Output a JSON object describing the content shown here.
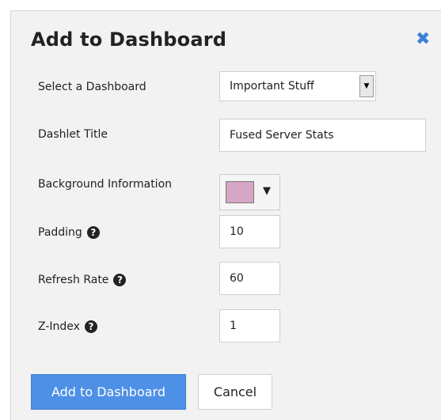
{
  "dialog": {
    "title": "Add to Dashboard",
    "close_icon": "close-icon"
  },
  "form": {
    "dashboard": {
      "label": "Select a Dashboard",
      "value": "Important Stuff"
    },
    "dashlet_title": {
      "label": "Dashlet Title",
      "value": "Fused Server Stats"
    },
    "background": {
      "label": "Background Information",
      "color": "#d7a6c6"
    },
    "padding": {
      "label": "Padding",
      "value": "10"
    },
    "refresh_rate": {
      "label": "Refresh Rate",
      "value": "60"
    },
    "z_index": {
      "label": "Z-Index",
      "value": "1"
    },
    "help_icon": "question-circle-icon"
  },
  "buttons": {
    "submit_label": "Add to Dashboard",
    "cancel_label": "Cancel"
  },
  "colors": {
    "accent": "#4d90e6",
    "close": "#3a82d9",
    "panel_bg": "#f2f2f2"
  }
}
